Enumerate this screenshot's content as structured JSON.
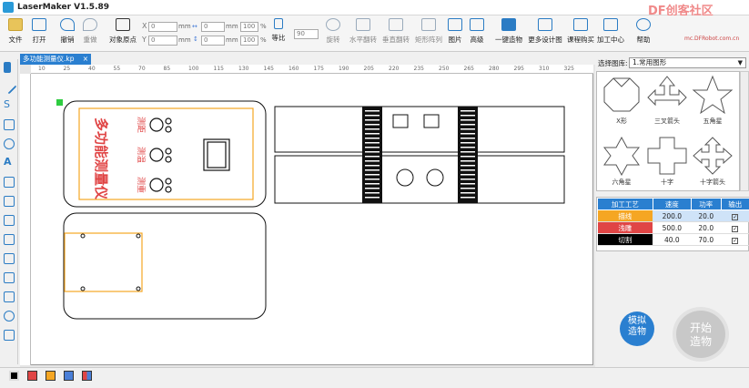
{
  "app": {
    "title": "LaserMaker V1.5.89",
    "watermark": "DF创客社区",
    "watermark_sub": "mc.DFRobot.com.cn"
  },
  "toolbar": {
    "file": "文件",
    "open": "打开",
    "undo": "撤销",
    "redo": "重做",
    "object_origin": "对象原点",
    "x_label": "X",
    "y_label": "Y",
    "x_value": "0",
    "y_value": "0",
    "w_value": "0",
    "h_value": "0",
    "unit": "mm",
    "sx_value": "100",
    "sy_value": "100",
    "pct": "%",
    "ratio": "等比",
    "rotate_value": "90",
    "rotate": "旋转",
    "flip_h": "水平翻转",
    "flip_v": "垂直翻转",
    "array": "矩形阵列",
    "image": "图片",
    "advanced": "高级",
    "one_click": "一键造物",
    "more_designs": "更多设计图",
    "buy_course": "课程购买",
    "process_center": "加工中心",
    "help": "帮助"
  },
  "document": {
    "tab_name": "多功能测量仪.kp",
    "tab_close": "×"
  },
  "ruler": {
    "h_ticks": [
      "10",
      "25",
      "40",
      "55",
      "70",
      "85",
      "100",
      "115",
      "130",
      "145",
      "160",
      "175",
      "190",
      "205",
      "220",
      "235",
      "250",
      "265",
      "280",
      "295",
      "310",
      "325"
    ]
  },
  "canvas": {
    "panel_title": "多功能测量仪",
    "labels": [
      "测距",
      "测温",
      "测重"
    ]
  },
  "library": {
    "label": "选择图库:",
    "selected": "1.常用图形",
    "arrow": "▼",
    "shapes": [
      {
        "name": "X形",
        "icon": "x-shape-icon"
      },
      {
        "name": "三叉箭头",
        "icon": "trident-arrow-icon"
      },
      {
        "name": "五角星",
        "icon": "five-star-icon"
      },
      {
        "name": "六角星",
        "icon": "six-star-icon"
      },
      {
        "name": "十字",
        "icon": "cross-icon"
      },
      {
        "name": "十字箭头",
        "icon": "cross-arrow-icon"
      }
    ]
  },
  "process_table": {
    "headers": [
      "加工工艺",
      "速度",
      "功率",
      "输出"
    ],
    "rows": [
      {
        "name": "描线",
        "speed": "200.0",
        "power": "20.0",
        "out": "✓",
        "color": "#f5a623"
      },
      {
        "name": "浅雕",
        "speed": "500.0",
        "power": "20.0",
        "out": "✓",
        "color": "#e04545"
      },
      {
        "name": "切割",
        "speed": "40.0",
        "power": "70.0",
        "out": "✓",
        "color": "#000000"
      }
    ]
  },
  "buttons": {
    "simulate": "模拟\n造物",
    "simulate_l1": "模拟",
    "simulate_l2": "造物",
    "start_l1": "开始",
    "start_l2": "造物"
  },
  "colors": {
    "accent": "#2a7fd0",
    "swatches": [
      "#000000",
      "#e04545",
      "#f5a623",
      "#4a7fd8",
      "multi"
    ]
  }
}
